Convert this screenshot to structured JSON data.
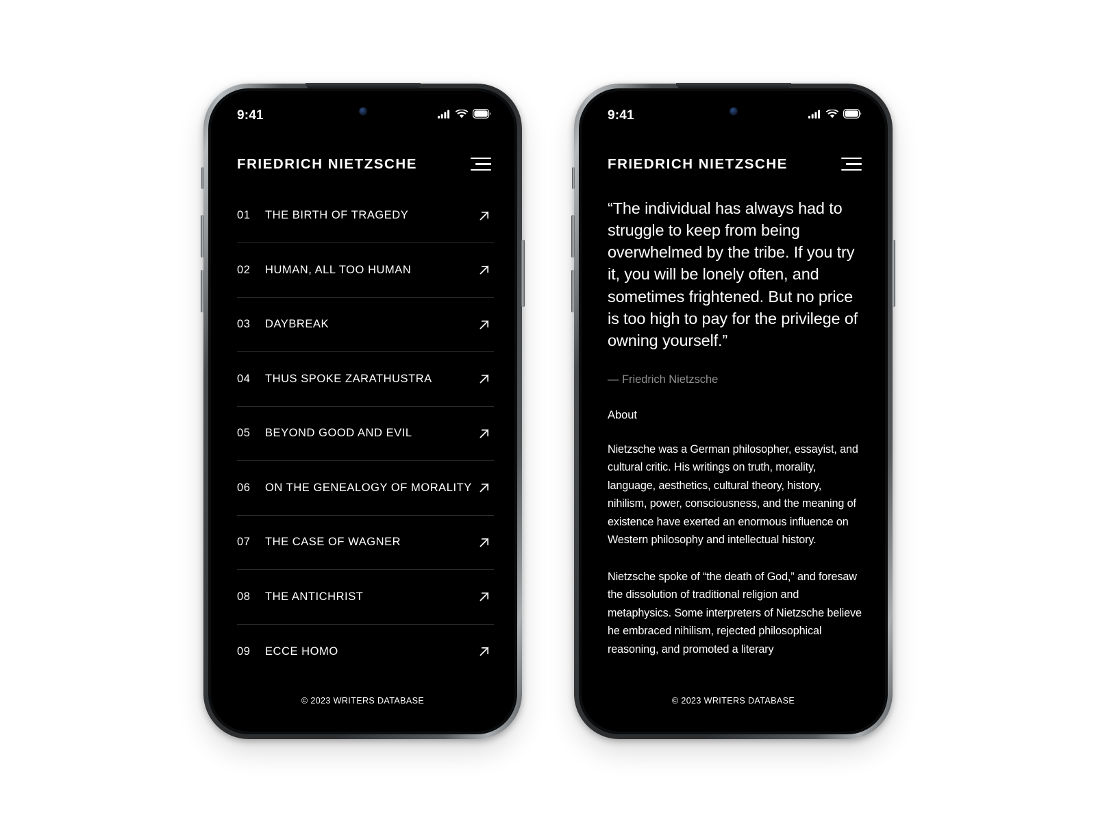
{
  "colors": {
    "screen_background": "#000000",
    "page_background": "#ffffff",
    "text_primary": "#ffffff",
    "text_muted": "#8e8e8e",
    "divider": "#2b2b2b"
  },
  "status_bar": {
    "time": "9:41",
    "cellular_icon": "cellular-bars-icon",
    "wifi_icon": "wifi-icon",
    "battery_icon": "battery-full-icon"
  },
  "header": {
    "brand": "FRIEDRICH NIETZSCHE",
    "menu_icon": "hamburger-menu-icon"
  },
  "footer": {
    "text": "© 2023 WRITERS DATABASE"
  },
  "screen_one": {
    "works": [
      {
        "number": "01",
        "title": "THE BIRTH OF TRAGEDY",
        "link_icon": "arrow-up-right-icon"
      },
      {
        "number": "02",
        "title": "HUMAN, ALL TOO HUMAN",
        "link_icon": "arrow-up-right-icon"
      },
      {
        "number": "03",
        "title": "DAYBREAK",
        "link_icon": "arrow-up-right-icon"
      },
      {
        "number": "04",
        "title": "THUS SPOKE ZARATHUSTRA",
        "link_icon": "arrow-up-right-icon"
      },
      {
        "number": "05",
        "title": "BEYOND GOOD AND EVIL",
        "link_icon": "arrow-up-right-icon"
      },
      {
        "number": "06",
        "title": "ON THE GENEALOGY OF MORALITY",
        "link_icon": "arrow-up-right-icon"
      },
      {
        "number": "07",
        "title": "THE CASE OF WAGNER",
        "link_icon": "arrow-up-right-icon"
      },
      {
        "number": "08",
        "title": "THE ANTICHRIST",
        "link_icon": "arrow-up-right-icon"
      },
      {
        "number": "09",
        "title": "ECCE HOMO",
        "link_icon": "arrow-up-right-icon"
      }
    ]
  },
  "screen_two": {
    "quote": "“The individual has always had to struggle to keep from being overwhelmed by the tribe. If you try it, you will be lonely often, and sometimes frightened. But no price is too high to pay for the privilege of owning yourself.”",
    "attribution": "— Friedrich Nietzsche",
    "about_heading": "About",
    "about_paragraph_1": "Nietzsche was a German philosopher, essayist, and cultural critic. His writings on truth, morality, language, aesthetics, cultural theory, history, nihilism, power, consciousness, and the meaning of existence have exerted an enormous influence on Western philosophy and intellectual history.",
    "about_paragraph_2": "Nietzsche spoke of “the death of God,” and foresaw the dissolution of traditional religion and metaphysics. Some interpreters of Nietzsche believe he embraced nihilism, rejected philosophical reasoning, and promoted a literary"
  }
}
